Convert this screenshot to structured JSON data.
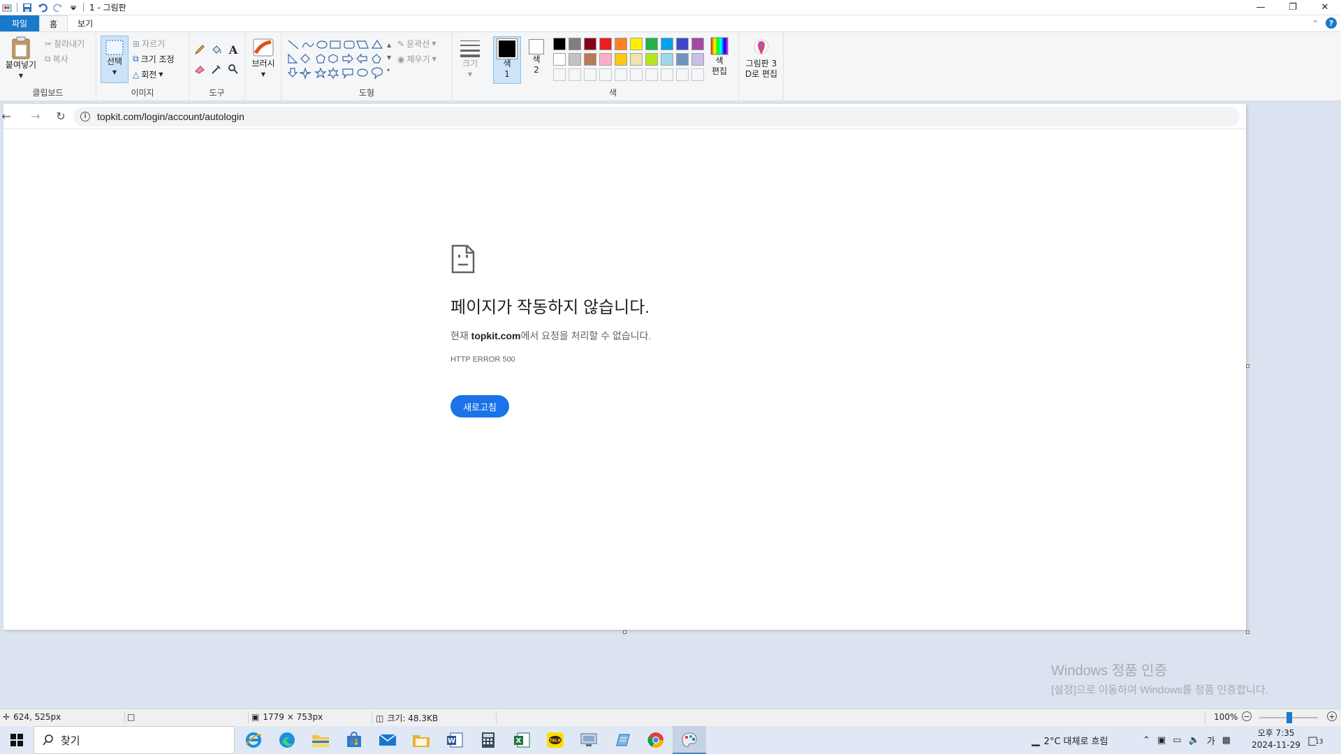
{
  "window": {
    "title": "1 - 그림판"
  },
  "tabs": [
    "파일",
    "홈",
    "보기"
  ],
  "ribbon": {
    "clipboard": {
      "paste": "붙여넣기",
      "cut": "잘라내기",
      "copy": "복사",
      "label": "클립보드"
    },
    "image": {
      "select": "선택",
      "crop": "자르기",
      "resize": "크기 조정",
      "rotate": "회전",
      "label": "이미지"
    },
    "tools": {
      "label": "도구"
    },
    "brushes": {
      "label": "브러시"
    },
    "shapes": {
      "outline": "윤곽선",
      "fill": "채우기",
      "label": "도형"
    },
    "size": {
      "label": "크기"
    },
    "colors": {
      "color1": "색\n1",
      "color2": "색\n2",
      "edit": "색\n편집",
      "label": "색",
      "row1": [
        "#000000",
        "#7f7f7f",
        "#880015",
        "#ed1c24",
        "#ff7f27",
        "#fff200",
        "#22b14c",
        "#00a2e8",
        "#3f48cc",
        "#a349a4"
      ],
      "row2": [
        "#ffffff",
        "#c3c3c3",
        "#b97a57",
        "#ffaec9",
        "#ffc90e",
        "#efe4b0",
        "#b5e61d",
        "#99d9ea",
        "#7092be",
        "#c8bfe7"
      ]
    },
    "paint3d": {
      "label": "그림판 3\nD로 편집"
    }
  },
  "browser": {
    "url": "topkit.com/login/account/autologin",
    "error_title": "페이지가 작동하지 않습니다.",
    "error_desc_prefix": "현재 ",
    "error_desc_host": "topkit.com",
    "error_desc_suffix": "에서 요청을 처리할 수 없습니다.",
    "error_code": "HTTP ERROR 500",
    "reload": "새로고침"
  },
  "watermark": {
    "line1": "Windows 정품 인증",
    "line2": "[설정]으로 이동하여 Windows를 정품 인증합니다."
  },
  "status": {
    "cursor": "624, 525px",
    "dimensions": "1779 × 753px",
    "filesize": "크기: 48.3KB",
    "zoom": "100%"
  },
  "taskbar": {
    "search_placeholder": "찾기",
    "weather": "2°C  대체로 흐림",
    "ime": "가",
    "time": "오후 7:35",
    "date": "2024-11-29",
    "notifications": "13"
  }
}
